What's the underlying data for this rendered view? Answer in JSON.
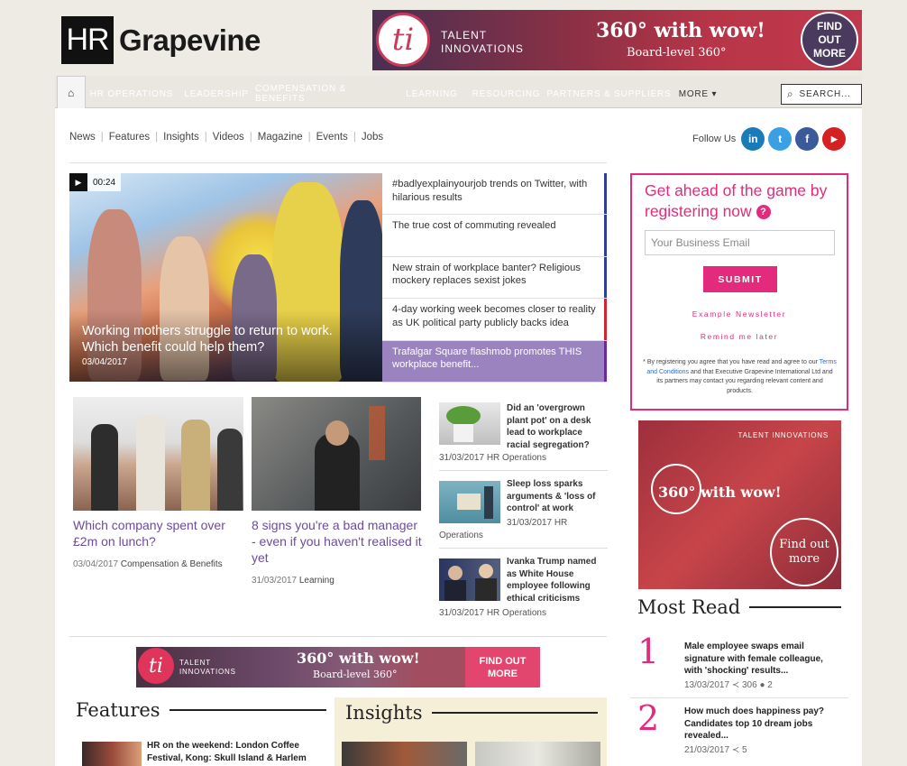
{
  "header": {
    "logo_hr": "HR",
    "logo_name": "Grapevine",
    "banner": {
      "logo_glyph": "ti",
      "brand_line1": "TALENT",
      "brand_line2": "INNOVATIONS",
      "headline": "360° with wow!",
      "sub": "Board-level 360°",
      "cta_line1": "FIND",
      "cta_line2": "OUT",
      "cta_line3": "MORE"
    }
  },
  "nav": {
    "home_icon": "home-icon",
    "items": [
      {
        "label": "HR OPERATIONS",
        "color": "#1f4aa8"
      },
      {
        "label": "LEADERSHIP",
        "color": "#222222"
      },
      {
        "label": "COMPENSATION & BENEFITS",
        "color": "#d12630"
      },
      {
        "label": "LEARNING",
        "color": "#2e8b3a"
      },
      {
        "label": "RESOURCING",
        "color": "#6a2a98"
      },
      {
        "label": "PARTNERS & SUPPLIERS",
        "color": "#5c7a8a"
      }
    ],
    "more_label": "MORE ▾",
    "search_placeholder": "SEARCH..."
  },
  "subnav": [
    "News",
    "Features",
    "Insights",
    "Videos",
    "Magazine",
    "Events",
    "Jobs"
  ],
  "follow": {
    "label": "Follow Us",
    "networks": [
      {
        "icon": "linkedin-icon",
        "glyph": "in",
        "color": "#1a7bb9"
      },
      {
        "icon": "twitter-icon",
        "glyph": "t",
        "color": "#3aa0e3"
      },
      {
        "icon": "facebook-icon",
        "glyph": "f",
        "color": "#3b5a9a"
      },
      {
        "icon": "youtube-icon",
        "glyph": "▶",
        "color": "#d42121"
      }
    ]
  },
  "hero": {
    "duration": "00:24",
    "title": "Working mothers struggle to return to work. Which benefit could help them?",
    "date": "03/04/2017"
  },
  "hero_list": [
    {
      "text": "#badlyexplainyourjob trends on Twitter, with hilarious results",
      "bar": "#2b3e9a"
    },
    {
      "text": "The true cost of commuting revealed",
      "bar": "#2b3e9a"
    },
    {
      "text": "New strain of workplace banter? Religious mockery replaces sexist jokes",
      "bar": "#2b3e9a"
    },
    {
      "text": "4-day working week becomes closer to reality as UK political party publicly backs idea",
      "bar": "#d12630"
    },
    {
      "text": "Trafalgar Square flashmob promotes THIS workplace benefit...",
      "bar": "#6a2a98"
    }
  ],
  "cards": [
    {
      "title": "Which company spent over £2m on lunch?",
      "date": "03/04/2017",
      "category": "Compensation & Benefits"
    },
    {
      "title": "8 signs you're a bad manager - even if you haven't realised it yet",
      "date": "31/03/2017",
      "category": "Learning"
    }
  ],
  "side_list": [
    {
      "title": "Did an 'overgrown plant pot' on a desk lead to workplace racial segregation?",
      "meta": "31/03/2017 HR Operations"
    },
    {
      "title": "Sleep loss sparks arguments & 'loss of control' at work",
      "meta_line1": "31/03/2017 HR",
      "meta_line2": "Operations"
    },
    {
      "title": "Ivanka Trump named as White House employee following ethical criticisms",
      "meta": "31/03/2017 HR Operations"
    }
  ],
  "register": {
    "heading": "Get ahead of the game by registering now",
    "help_icon": "?",
    "email_placeholder": "Your Business Email",
    "submit": "SUBMIT",
    "example_link": "Example Newsletter",
    "remind_link": "Remind me later",
    "legal_before": "* By registering you agree that you have read and agree to our ",
    "legal_terms": "Terms and Conditions",
    "legal_after": " and that Executive Grapevine International Ltd and its partners may contact you regarding relevant content and products."
  },
  "side_ad": {
    "brand": "TALENT INNOVATIONS",
    "headline": "360° with wow!",
    "cta": "Find out more"
  },
  "most_read": {
    "heading": "Most Read",
    "items": [
      {
        "num": "1",
        "title": "Male employee swaps email signature with female colleague, with 'shocking' results...",
        "meta": "13/03/2017 ≺ 306 ● 2"
      },
      {
        "num": "2",
        "title": "How much does happiness pay? Candidates top 10 dream jobs revealed...",
        "meta": "21/03/2017 ≺ 5"
      }
    ]
  },
  "mid_ad": {
    "logo_glyph": "ti",
    "brand_line1": "TALENT",
    "brand_line2": "INNOVATIONS",
    "headline": "360° with wow!",
    "sub": "Board-level 360°",
    "cta_line1": "FIND OUT",
    "cta_line2": "MORE"
  },
  "features": {
    "heading": "Features",
    "first_item": "HR on the weekend: London Coffee Festival, Kong: Skull Island & Harlem"
  },
  "insights": {
    "heading": "Insights"
  }
}
